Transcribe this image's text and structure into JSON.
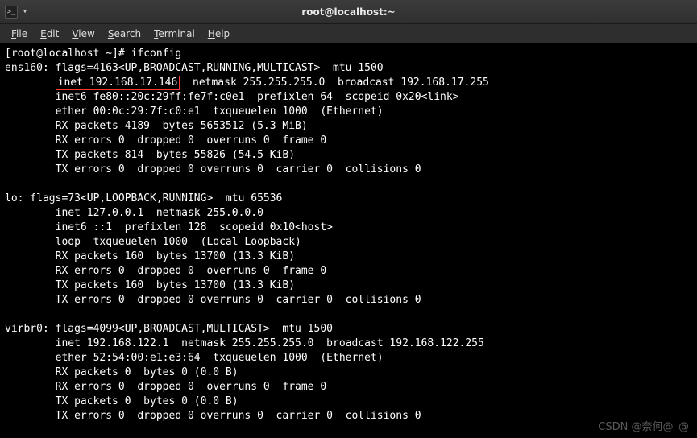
{
  "window": {
    "title": "root@localhost:~"
  },
  "menu": {
    "file": "File",
    "edit": "Edit",
    "view": "View",
    "search": "Search",
    "terminal": "Terminal",
    "help": "Help"
  },
  "prompt": {
    "line": "[root@localhost ~]# ",
    "command": "ifconfig"
  },
  "ifconfig": {
    "ens160": {
      "header": "ens160: flags=4163<UP,BROADCAST,RUNNING,MULTICAST>  mtu 1500",
      "inet_boxed": "inet 192.168.17.146",
      "inet_rest": "  netmask 255.255.255.0  broadcast 192.168.17.255",
      "inet6": "        inet6 fe80::20c:29ff:fe7f:c0e1  prefixlen 64  scopeid 0x20<link>",
      "ether": "        ether 00:0c:29:7f:c0:e1  txqueuelen 1000  (Ethernet)",
      "rx_packets": "        RX packets 4189  bytes 5653512 (5.3 MiB)",
      "rx_errors": "        RX errors 0  dropped 0  overruns 0  frame 0",
      "tx_packets": "        TX packets 814  bytes 55826 (54.5 KiB)",
      "tx_errors": "        TX errors 0  dropped 0 overruns 0  carrier 0  collisions 0"
    },
    "lo": {
      "header": "lo: flags=73<UP,LOOPBACK,RUNNING>  mtu 65536",
      "inet": "        inet 127.0.0.1  netmask 255.0.0.0",
      "inet6": "        inet6 ::1  prefixlen 128  scopeid 0x10<host>",
      "loop": "        loop  txqueuelen 1000  (Local Loopback)",
      "rx_packets": "        RX packets 160  bytes 13700 (13.3 KiB)",
      "rx_errors": "        RX errors 0  dropped 0  overruns 0  frame 0",
      "tx_packets": "        TX packets 160  bytes 13700 (13.3 KiB)",
      "tx_errors": "        TX errors 0  dropped 0 overruns 0  carrier 0  collisions 0"
    },
    "virbr0": {
      "header": "virbr0: flags=4099<UP,BROADCAST,MULTICAST>  mtu 1500",
      "inet": "        inet 192.168.122.1  netmask 255.255.255.0  broadcast 192.168.122.255",
      "ether": "        ether 52:54:00:e1:e3:64  txqueuelen 1000  (Ethernet)",
      "rx_packets": "        RX packets 0  bytes 0 (0.0 B)",
      "rx_errors": "        RX errors 0  dropped 0  overruns 0  frame 0",
      "tx_packets": "        TX packets 0  bytes 0 (0.0 B)",
      "tx_errors": "        TX errors 0  dropped 0 overruns 0  carrier 0  collisions 0"
    }
  },
  "inet_indent": "        ",
  "watermark": "CSDN @奈何@_@"
}
